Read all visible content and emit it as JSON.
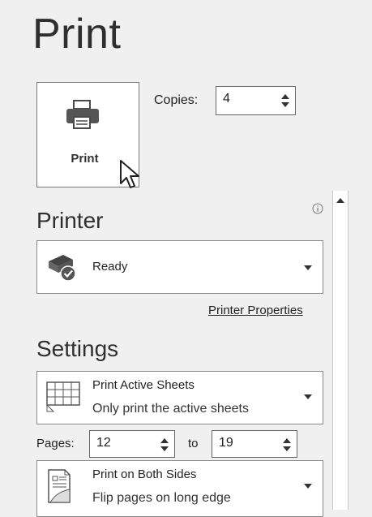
{
  "page": {
    "title": "Print"
  },
  "print_button": {
    "label": "Print"
  },
  "copies": {
    "label": "Copies:",
    "value": "4"
  },
  "printer": {
    "heading": "Printer",
    "status": "Ready",
    "properties_link": "Printer Properties"
  },
  "settings": {
    "heading": "Settings",
    "sheets": {
      "title": "Print Active Sheets",
      "subtitle": "Only print the active sheets"
    },
    "pages": {
      "label": "Pages:",
      "from": "12",
      "to_label": "to",
      "to": "19"
    },
    "sides": {
      "title": "Print on Both Sides",
      "subtitle": "Flip pages on long edge"
    }
  },
  "icons": {
    "printer": "printer-icon",
    "cursor": "mouse-pointer-icon",
    "info": "info-icon",
    "printer_status": "printer-ready-icon",
    "sheets": "spreadsheet-icon",
    "duplex": "duplex-page-icon"
  }
}
